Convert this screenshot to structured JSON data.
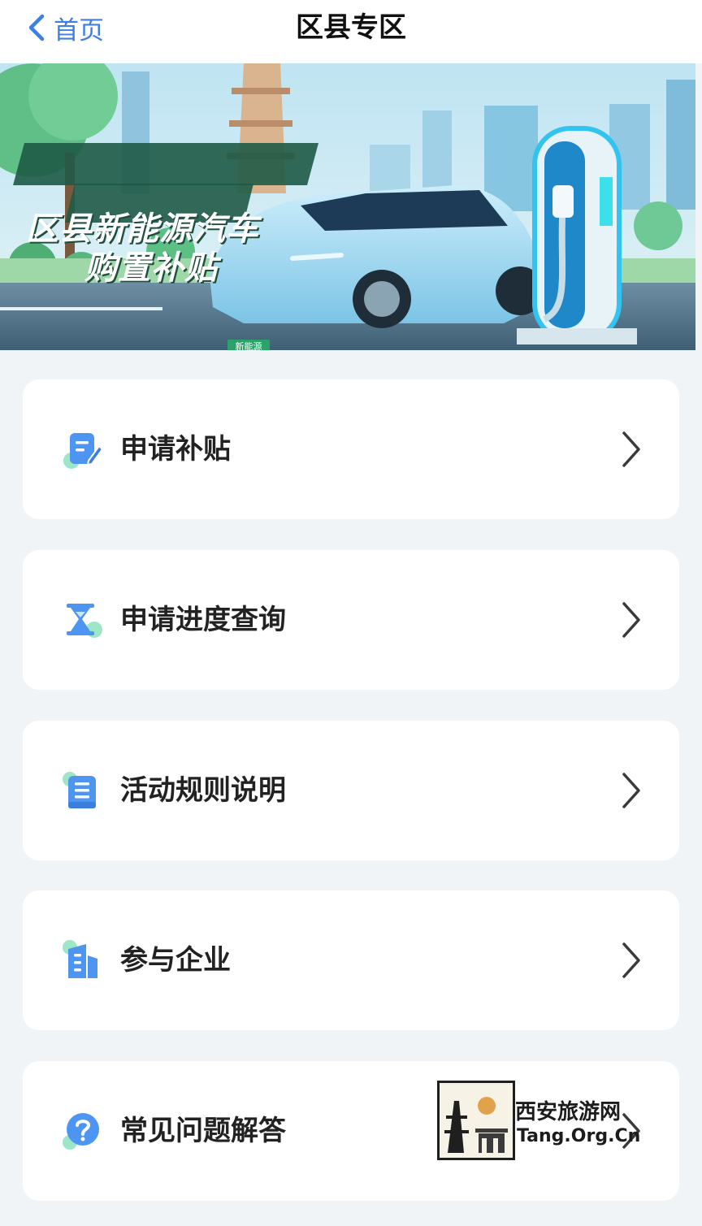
{
  "nav": {
    "back_label": "首页",
    "title": "区县专区"
  },
  "banner": {
    "title_line1": "区县新能源汽车",
    "title_line2": "购置补贴",
    "plate_text": "新能源"
  },
  "menu": [
    {
      "label": "申请补贴",
      "icon": "edit-doc-icon"
    },
    {
      "label": "申请进度查询",
      "icon": "hourglass-icon"
    },
    {
      "label": "活动规则说明",
      "icon": "rule-book-icon"
    },
    {
      "label": "参与企业",
      "icon": "enterprise-building-icon"
    },
    {
      "label": "常见问题解答",
      "icon": "question-icon"
    }
  ],
  "watermark": {
    "name": "西安旅游网",
    "url": "Tang.Org.Cn"
  },
  "colors": {
    "accent": "#3d7fe3",
    "icon_blue": "#4d95f0",
    "icon_green": "#9ee6c8",
    "background": "#f0f4f6"
  }
}
